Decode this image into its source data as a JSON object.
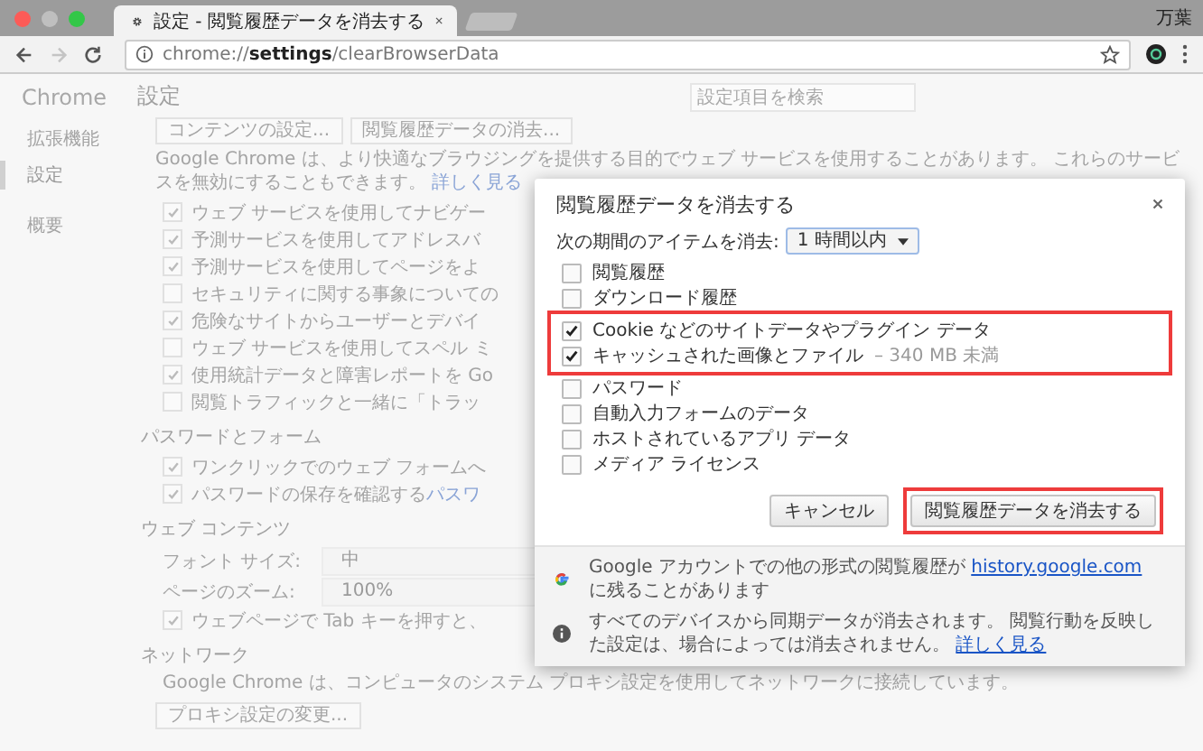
{
  "browser": {
    "tab_title": "設定 - 閲覧履歴データを消去する",
    "profile_name": "万葉",
    "address": "chrome://**settings**/clearBrowserData",
    "forward_disabled": true
  },
  "sidebar": {
    "title": "Chrome",
    "items": [
      {
        "label": "拡張機能",
        "selected": false
      },
      {
        "label": "設定",
        "selected": true
      },
      {
        "label": "概要",
        "selected": false
      }
    ]
  },
  "settings": {
    "title": "設定",
    "search": {
      "placeholder": "設定項目を検索"
    },
    "buttons": [
      "コンテンツの設定...",
      "閲覧履歴データの消去..."
    ],
    "privacy_text": "Google Chrome は、より快適なブラウジングを提供する目的でウェブ サービスを使用することがあります。 これらのサービスを無効にすることもできます。",
    "privacy_link": "詳しく見る",
    "privacy_options": [
      {
        "label": "ウェブ サービスを使用してナビゲー",
        "checked": true
      },
      {
        "label": "予測サービスを使用してアドレスバ",
        "checked": true
      },
      {
        "label": "予測サービスを使用してページをよ",
        "checked": true
      },
      {
        "label": "セキュリティに関する事象についての",
        "checked": false
      },
      {
        "label": "危険なサイトからユーザーとデバイ",
        "checked": true
      },
      {
        "label": "ウェブ サービスを使用してスペル ミ",
        "checked": false
      },
      {
        "label": "使用統計データと障害レポートを Go",
        "checked": true
      },
      {
        "label": "閲覧トラフィックと一緒に「トラッ",
        "checked": false
      }
    ],
    "sections": [
      {
        "title": "パスワードとフォーム",
        "rows": [
          {
            "kind": "checkbox",
            "label": "ワンクリックでのウェブ フォームへ",
            "checked": true
          },
          {
            "kind": "checkbox",
            "label": "パスワードの保存を確認する",
            "link": "パスワ",
            "checked": true
          }
        ]
      },
      {
        "title": "ウェブ コンテンツ",
        "rows": [
          {
            "kind": "select",
            "label": "フォント サイズ:",
            "value": "中"
          },
          {
            "kind": "select",
            "label": "ページのズーム:",
            "value": "100%"
          },
          {
            "kind": "checkbox",
            "label": "ウェブページで Tab キーを押すと、",
            "checked": true
          }
        ]
      },
      {
        "title": "ネットワーク",
        "rows": [
          {
            "kind": "text",
            "label": "Google Chrome は、コンピュータのシステム プロキシ設定を使用してネットワークに接続しています。"
          },
          {
            "kind": "button",
            "label": "プロキシ設定の変更..."
          }
        ]
      }
    ]
  },
  "dialog": {
    "title": "閲覧履歴データを消去する",
    "period_label": "次の期間のアイテムを消去:",
    "period": "1 時間以内",
    "items": [
      {
        "label": "閲覧履歴",
        "checked": false,
        "highlighted": false
      },
      {
        "label": "ダウンロード履歴",
        "checked": false,
        "highlighted": false
      },
      {
        "label": "Cookie などのサイトデータやプラグイン データ",
        "checked": true,
        "highlighted": true
      },
      {
        "label": "キャッシュされた画像とファイル",
        "note": "– 340 MB 未満",
        "checked": true,
        "highlighted": true
      },
      {
        "label": "パスワード",
        "checked": false,
        "highlighted": false
      },
      {
        "label": "自動入力フォームのデータ",
        "checked": false,
        "highlighted": false
      },
      {
        "label": "ホストされているアプリ データ",
        "checked": false,
        "highlighted": false
      },
      {
        "label": "メディア ライセンス",
        "checked": false,
        "highlighted": false
      }
    ],
    "buttons": [
      {
        "label": "キャンセル",
        "highlighted": false
      },
      {
        "label": "閲覧履歴データを消去する",
        "highlighted": true
      }
    ],
    "notes": [
      {
        "kind": "google",
        "text": "Google アカウントでの他の形式の閲覧履歴が",
        "link": "history.google.com",
        "text_after": "に残ることがあります"
      },
      {
        "kind": "info",
        "text": "すべてのデバイスから同期データが消去されます。 閲覧行動を反映した設定は、場合によっては消去されません。",
        "link": "詳しく見る"
      }
    ]
  }
}
